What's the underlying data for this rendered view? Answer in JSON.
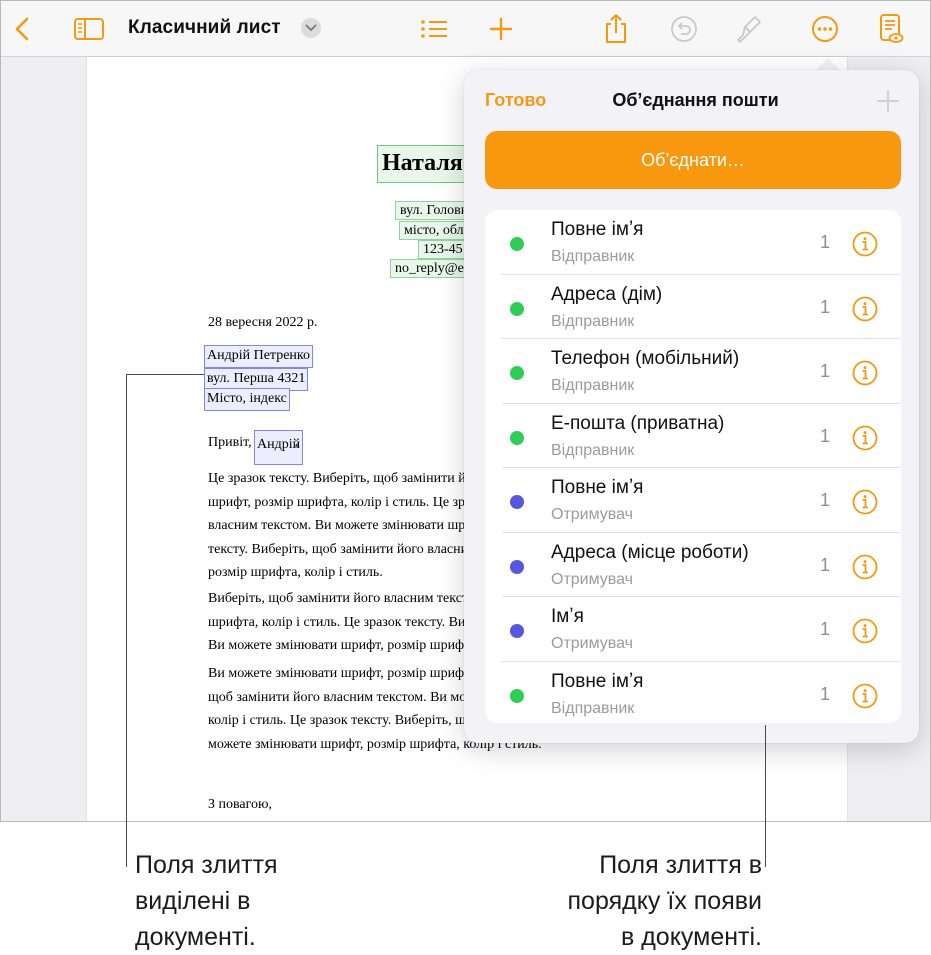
{
  "colors": {
    "accent": "#f39a12",
    "merge_button": "#f7980f",
    "sender_dot": "#2fcd56",
    "recipient_dot": "#5557dd",
    "sender_field_fill": "#e8f7ea",
    "recipient_field_fill": "#eceefe"
  },
  "toolbar": {
    "back_icon": "chevron-left-icon",
    "sidebar_icon": "sidebar-icon",
    "document_title": "Класичний лист",
    "title_menu_icon": "chevron-down-icon",
    "format_list_icon": "list-icon",
    "insert_icon": "plus-icon",
    "share_icon": "share-icon",
    "undo_icon": "undo-icon",
    "format_icon": "paintbrush-icon",
    "more_icon": "ellipsis-circle-icon",
    "reading_view_icon": "document-view-icon"
  },
  "document": {
    "sender_name": "Наталя",
    "sender_lines": [
      "вул. Головн",
      "місто, обла",
      "123-45",
      "no_reply@e"
    ],
    "date": "28 вересня 2022 р.",
    "recipient_lines": [
      "Андрій Петренко",
      "вул. Перша 4321",
      "Місто, індекс"
    ],
    "greeting_prefix": "Привіт,",
    "greeting_field": "Андрій",
    "greeting_suffix": ",",
    "paragraphs": [
      [
        "Це зразок тексту. Виберіть, щоб замінити йог",
        "шрифт, розмір шрифта, колір і стиль. Це зра",
        "власним текстом. Ви можете змінювати шри",
        "тексту. Виберіть, щоб замінити його власни",
        "розмір шрифта, колір і стиль."
      ],
      [
        "Виберіть, щоб замінити його власним тексто",
        "шрифта, колір і стиль. Це зразок тексту. Ви",
        "Ви можете змінювати шрифт, розмір шрифта"
      ],
      [
        "Ви можете змінювати шрифт, розмір шрифт",
        "щоб замінити його власним текстом. Ви мож",
        "колір і стиль. Це зразок тексту. Виберіть, щ",
        "можете змінювати шрифт, розмір шрифта, колір і стиль."
      ]
    ],
    "closing": "З повагою,"
  },
  "popover": {
    "done_label": "Готово",
    "title": "Об’єднання пошти",
    "add_icon": "plus-icon",
    "merge_button_label": "Об’єднати…",
    "info_icon": "info-circle-icon",
    "fields": [
      {
        "label": "Повне імʼя",
        "source": "Відправник",
        "count": "1",
        "role": "sender"
      },
      {
        "label": "Адреса (дім)",
        "source": "Відправник",
        "count": "1",
        "role": "sender"
      },
      {
        "label": "Телефон (мобільний)",
        "source": "Відправник",
        "count": "1",
        "role": "sender"
      },
      {
        "label": "Е-пошта (приватна)",
        "source": "Відправник",
        "count": "1",
        "role": "sender"
      },
      {
        "label": "Повне імʼя",
        "source": "Отримувач",
        "count": "1",
        "role": "recipient"
      },
      {
        "label": "Адреса (місце роботи)",
        "source": "Отримувач",
        "count": "1",
        "role": "recipient"
      },
      {
        "label": "Імʼя",
        "source": "Отримувач",
        "count": "1",
        "role": "recipient"
      },
      {
        "label": "Повне імʼя",
        "source": "Відправник",
        "count": "1",
        "role": "sender"
      }
    ]
  },
  "callouts": {
    "left": [
      "Поля злиття",
      "виділені в",
      "документі."
    ],
    "right": [
      "Поля злиття в",
      "порядку їх появи",
      "в документі."
    ]
  }
}
